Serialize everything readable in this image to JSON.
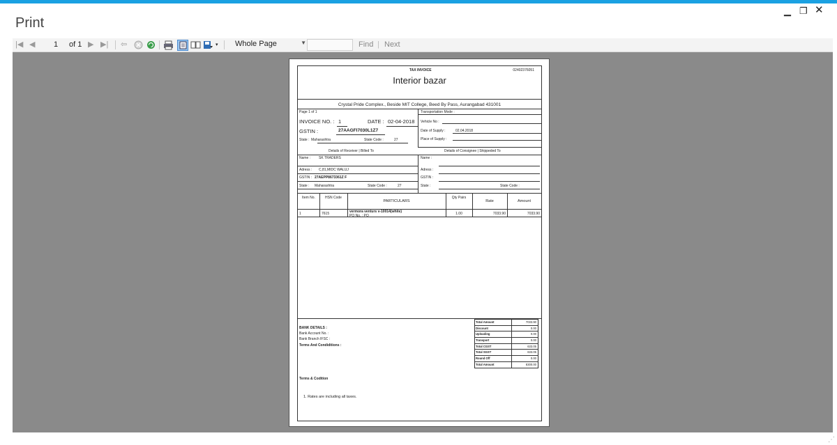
{
  "window": {
    "title": "Print",
    "minimize_icon": "minimize-icon",
    "restore_icon": "restore-icon",
    "close_icon": "close-icon"
  },
  "toolbar": {
    "page_number": "1",
    "page_of": "of 1",
    "zoom": "Whole Page",
    "find_label": "Find",
    "separator": "|",
    "next_label": "Next",
    "icons": [
      "first-page-icon",
      "previous-page-icon",
      "next-page-icon",
      "last-page-icon",
      "back-icon",
      "stop-icon",
      "refresh-icon",
      "print-icon",
      "print-layout-icon",
      "page-setup-icon",
      "export-icon"
    ]
  },
  "invoice": {
    "doc_type": "TAX INVOICE",
    "doc_number": "02402376051",
    "shop_name": "Interior bazar",
    "address": "Crystal Pride Complex., Beside MIT College, Beed By Pass, Aurangabad 431001",
    "page": "Page 1 of 1",
    "invoice_label": "INVOICE NO. :",
    "invoice_no": "1",
    "date_label": "DATE :",
    "date": "02-04-2018",
    "gstin_label": "GSTIN :",
    "gstin": "27AAGFI7030L1Z7",
    "state_label": "State :",
    "state": "Maharashtra",
    "state_code_label": "State Code :",
    "state_code": "27",
    "transport_mode_label": "Transportation Mode :",
    "vehicle_label": "Vehicle No :",
    "supply_date_label": "Date of Supply :",
    "supply_date": "02.04.2018",
    "supply_place_label": "Place of Supply :",
    "receiver_heading": "Details of Receiver | Billed To",
    "consignee_heading": "Details of Consignee | Shippeded To",
    "receiver": {
      "name_label": "Name :",
      "name": "SK TRADERS",
      "address_label": "Adress :",
      "address": "C,81,MIDC WALUJ",
      "gstin_label": "GSTIN :",
      "gstin": "27AEPP8673361Z F",
      "state_label": "State :",
      "state": "Maharashtra",
      "state_code_label": "State Code :",
      "state_code": "27"
    },
    "consignee": {
      "name_label": "Name :",
      "address_label": "Adress :",
      "gstin_label": "GSTIN :",
      "state_label": "State :",
      "state_code_label": "State Code :"
    },
    "columns": {
      "item_no": "Item No.",
      "hsn": "HSN Code",
      "particulars": "PARTICULARS",
      "qty": "Qty Pairs",
      "rate": "Rate",
      "amount": "Amount"
    },
    "items": [
      {
        "no": "1",
        "hsn": "7615",
        "desc": "vermora venturs v-10014(white)",
        "po": "PO No. : PO",
        "qty": "1.00",
        "rate": "7033.90",
        "amount": "7033.90"
      }
    ],
    "bank": {
      "heading": "BANK DETAILS :",
      "account": "Bank Account No. :",
      "branch": "Bank Branch IFSC :"
    },
    "terms_heading": "Terms And Condiditions :",
    "terms_sub": "Terms & Codition",
    "terms_line": "1.   Rates are including all taxes.",
    "totals": [
      {
        "label": "Total Amount",
        "value": "7033.90"
      },
      {
        "label": "Discount",
        "value": "0.00"
      },
      {
        "label": "Uploading",
        "value": "0.00"
      },
      {
        "label": "Transport",
        "value": "0.00"
      },
      {
        "label": "Total CGST",
        "value": "633.05"
      },
      {
        "label": "Total SGST",
        "value": "633.05"
      },
      {
        "label": "Round Off",
        "value": "0.00"
      },
      {
        "label": "Total Amount",
        "value": "8300.00"
      }
    ]
  },
  "colors": {
    "accent": "#1ba1e2",
    "viewer_bg": "#8a8a8a"
  }
}
